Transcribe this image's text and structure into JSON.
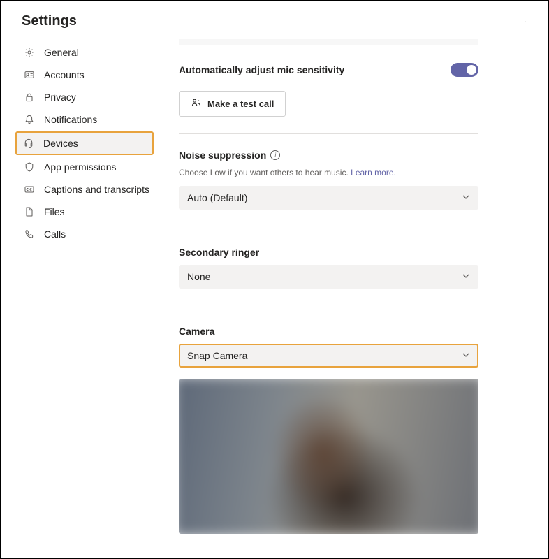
{
  "title": "Settings",
  "sidebar": {
    "items": [
      {
        "label": "General",
        "icon": "gear-icon"
      },
      {
        "label": "Accounts",
        "icon": "id-card-icon"
      },
      {
        "label": "Privacy",
        "icon": "lock-icon"
      },
      {
        "label": "Notifications",
        "icon": "bell-icon"
      },
      {
        "label": "Devices",
        "icon": "headset-icon",
        "active": true
      },
      {
        "label": "App permissions",
        "icon": "shield-icon"
      },
      {
        "label": "Captions and transcripts",
        "icon": "cc-icon"
      },
      {
        "label": "Files",
        "icon": "file-icon"
      },
      {
        "label": "Calls",
        "icon": "phone-icon"
      }
    ]
  },
  "content": {
    "auto_mic": {
      "label": "Automatically adjust mic sensitivity",
      "enabled": true
    },
    "test_call_label": "Make a test call",
    "noise_suppression": {
      "title": "Noise suppression",
      "helper": "Choose Low if you want others to hear music.",
      "learn_more": "Learn more.",
      "value": "Auto (Default)"
    },
    "secondary_ringer": {
      "title": "Secondary ringer",
      "value": "None"
    },
    "camera": {
      "title": "Camera",
      "value": "Snap Camera"
    }
  },
  "colors": {
    "accent": "#6264a7",
    "highlight": "#e8a33d"
  }
}
